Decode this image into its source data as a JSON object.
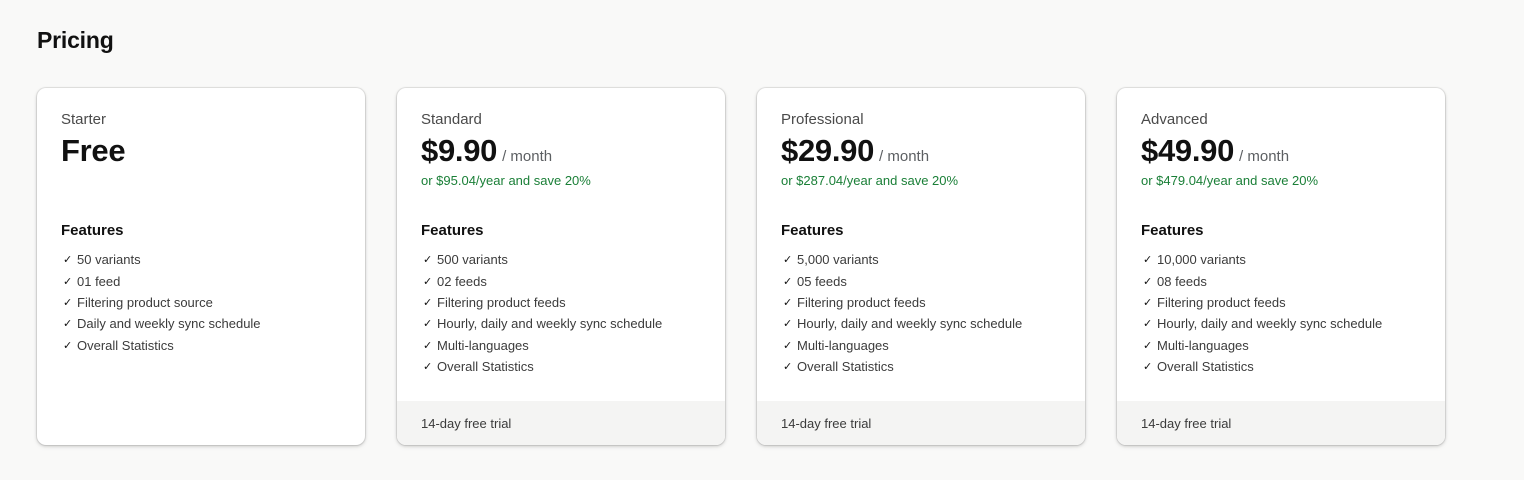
{
  "page": {
    "title": "Pricing"
  },
  "plans": [
    {
      "name": "Starter",
      "price": "Free",
      "period": "",
      "yearly": "",
      "features_title": "Features",
      "features": [
        "50 variants",
        "01 feed",
        "Filtering product source",
        "Daily and weekly sync schedule",
        "Overall Statistics"
      ],
      "footer": ""
    },
    {
      "name": "Standard",
      "price": "$9.90",
      "period": "/ month",
      "yearly": "or $95.04/year and save 20%",
      "features_title": "Features",
      "features": [
        "500 variants",
        "02 feeds",
        "Filtering product feeds",
        "Hourly, daily and weekly sync schedule",
        "Multi-languages",
        "Overall Statistics"
      ],
      "footer": "14-day free trial"
    },
    {
      "name": "Professional",
      "price": "$29.90",
      "period": "/ month",
      "yearly": "or $287.04/year and save 20%",
      "features_title": "Features",
      "features": [
        "5,000 variants",
        "05 feeds",
        "Filtering product feeds",
        "Hourly, daily and weekly sync schedule",
        "Multi-languages",
        "Overall Statistics"
      ],
      "footer": "14-day free trial"
    },
    {
      "name": "Advanced",
      "price": "$49.90",
      "period": "/ month",
      "yearly": "or $479.04/year and save 20%",
      "features_title": "Features",
      "features": [
        "10,000 variants",
        "08 feeds",
        "Filtering product feeds",
        "Hourly, daily and weekly sync schedule",
        "Multi-languages",
        "Overall Statistics"
      ],
      "footer": "14-day free trial"
    }
  ],
  "icons": {
    "feature_check": "checkmark-icon",
    "check_glyph": "✓"
  },
  "colors": {
    "savings": "#1a7f37",
    "footer_bg": "#f4f4f3",
    "page_bg": "#f9f9f8"
  }
}
